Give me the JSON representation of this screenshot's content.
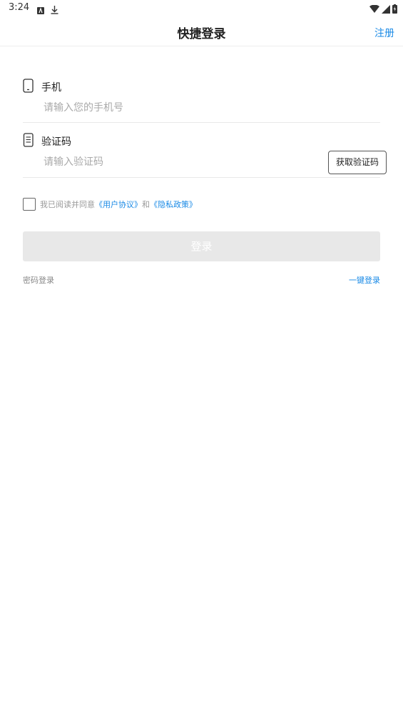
{
  "status_bar": {
    "time": "3:24"
  },
  "header": {
    "title": "快捷登录",
    "register_label": "注册"
  },
  "phone_field": {
    "label": "手机",
    "placeholder": "请输入您的手机号",
    "icon": "phone-icon"
  },
  "code_field": {
    "label": "验证码",
    "placeholder": "请输入验证码",
    "icon": "document-icon",
    "get_code_label": "获取验证码"
  },
  "agreement": {
    "prefix": "我已阅读并同意",
    "user_agreement": "《用户协议》",
    "and": "和",
    "privacy_policy": "《隐私政策》"
  },
  "login_button": {
    "label": "登录"
  },
  "bottom_links": {
    "password_login": "密码登录",
    "one_click_login": "一键登录"
  },
  "colors": {
    "accent": "#1a8ae6",
    "disabled_button": "#e8e8e8",
    "placeholder": "#aaaaaa"
  }
}
